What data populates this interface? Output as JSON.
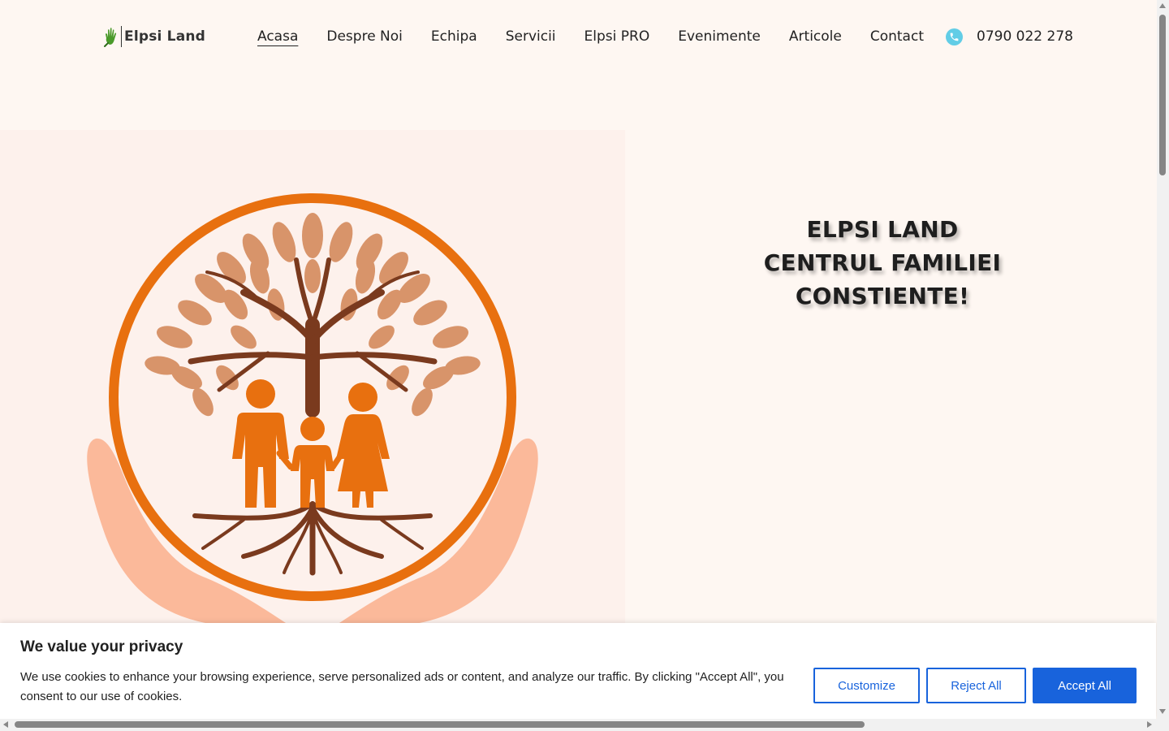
{
  "header": {
    "logo_text": "Elpsi Land",
    "nav": [
      {
        "label": "Acasa",
        "active": true
      },
      {
        "label": "Despre Noi"
      },
      {
        "label": "Echipa"
      },
      {
        "label": "Servicii"
      },
      {
        "label": "Elpsi PRO"
      },
      {
        "label": "Evenimente"
      },
      {
        "label": "Articole"
      },
      {
        "label": "Contact"
      }
    ],
    "phone": "0790 022 278",
    "phone_icon": "phone-icon"
  },
  "hero": {
    "title_lines": [
      "ELPSI LAND",
      "CENTRUL FAMILIEI",
      "CONSTIENTE!"
    ],
    "image_icon": "family-tree-hands-logo"
  },
  "cookie": {
    "title": "We value your privacy",
    "text": "We use cookies to enhance your browsing experience, serve personalized ads or content, and analyze our traffic. By clicking \"Accept All\", you consent to our use of cookies.",
    "customize_label": "Customize",
    "reject_label": "Reject All",
    "accept_label": "Accept All"
  },
  "colors": {
    "background": "#fef7f2",
    "accent_blue": "#1863dc",
    "orange": "#e8700f",
    "brown": "#7a3a1e",
    "leaf": "#d8946a",
    "hands": "#fbb99a",
    "phone_icon": "#62cde6"
  }
}
